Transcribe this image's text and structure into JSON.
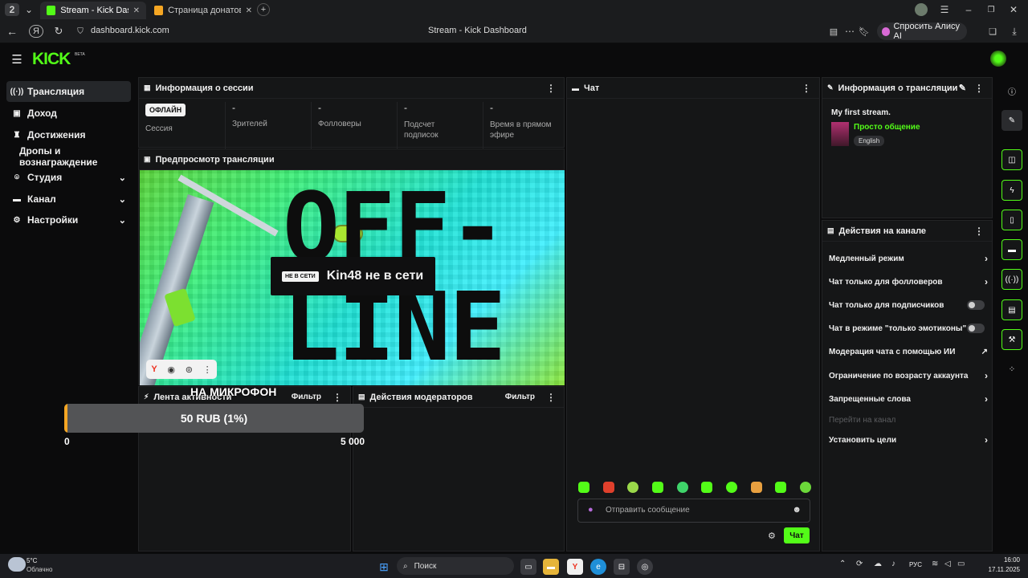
{
  "browser": {
    "tab_count": "2",
    "tabs": [
      {
        "label": "Stream - Kick Dashboard"
      },
      {
        "label": "Страница донатов - Dona"
      }
    ],
    "url": "dashboard.kick.com",
    "page_title": "Stream - Kick Dashboard",
    "alice_button": "Спросить Алису AI"
  },
  "app": {
    "logo": "KICK",
    "logo_badge": "BETA"
  },
  "sidebar": {
    "items": [
      {
        "label": "Трансляция"
      },
      {
        "label": "Доход"
      },
      {
        "label": "Достижения"
      },
      {
        "label": "Дропы и вознаграждение"
      },
      {
        "label": "Студия"
      },
      {
        "label": "Канал"
      },
      {
        "label": "Настройки"
      }
    ]
  },
  "session": {
    "title": "Информация о сессии",
    "status_badge": "ОФЛАЙН",
    "stats": [
      {
        "value": "",
        "label": "Сессия"
      },
      {
        "value": "-",
        "label": "Зрителей"
      },
      {
        "value": "-",
        "label": "Фолловеры"
      },
      {
        "value": "-",
        "label": "Подсчет подписок"
      },
      {
        "value": "-",
        "label": "Время в прямом эфире"
      }
    ]
  },
  "preview": {
    "title": "Предпросмотр трансляции",
    "offline_badge": "НЕ В СЕТИ",
    "offline_text": "Kin48 не в сети",
    "big_text_1": "OFF-",
    "big_text_2": "LINE"
  },
  "activity": {
    "title": "Лента активности",
    "filter": "Фильтр"
  },
  "moderators": {
    "title": "Действия модераторов",
    "filter": "Фильтр"
  },
  "donation_widget": {
    "label": "НА МИКРОФОН",
    "progress_text": "50 RUB (1%)",
    "progress_fraction": 0.01,
    "min": "0",
    "max": "5 000"
  },
  "chat": {
    "title": "Чат",
    "placeholder": "Отправить сообщение",
    "send": "Чат"
  },
  "stream_info": {
    "title": "Информация о трансляции",
    "stream_title": "My first stream.",
    "category": "Просто общение",
    "language": "English"
  },
  "channel_actions": {
    "title": "Действия на канале",
    "items": [
      {
        "label": "Медленный режим",
        "control": "chevron"
      },
      {
        "label": "Чат только для фолловеров",
        "control": "chevron"
      },
      {
        "label": "Чат только для подписчиков",
        "control": "toggle"
      },
      {
        "label": "Чат в режиме \"только эмотиконы\"",
        "control": "toggle"
      },
      {
        "label": "Модерация чата с помощью ИИ",
        "control": "external"
      },
      {
        "label": "Ограничение по возрасту аккаунта",
        "control": "chevron"
      },
      {
        "label": "Запрещенные слова",
        "control": "chevron"
      },
      {
        "label": "Перейти на канал",
        "control": "none"
      },
      {
        "label": "Установить цели",
        "control": "chevron"
      }
    ]
  },
  "taskbar": {
    "weather_temp": "5°C",
    "weather_desc": "Облачно",
    "search": "Поиск",
    "lang": "РУС",
    "time": "16:00",
    "date": "17.11.2025"
  },
  "colors": {
    "accent": "#53fc18",
    "panel": "#151617",
    "bg": "#0b0b0c"
  }
}
